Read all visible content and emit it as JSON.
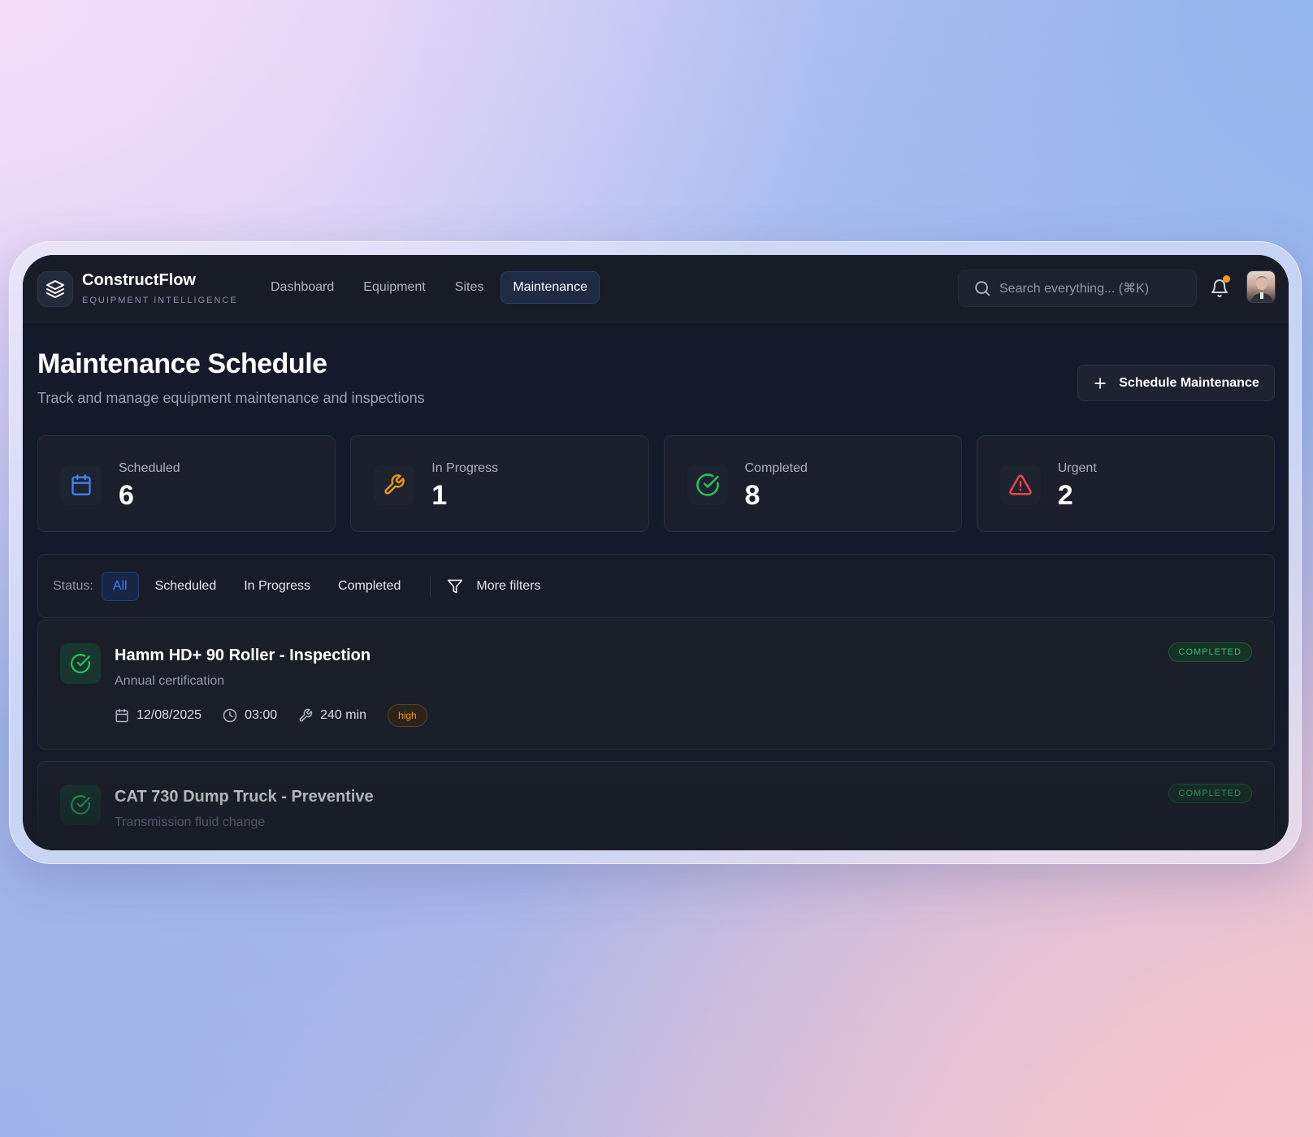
{
  "app": {
    "name": "ConstructFlow",
    "tagline": "EQUIPMENT INTELLIGENCE"
  },
  "nav": {
    "items": [
      {
        "label": "Dashboard",
        "active": false
      },
      {
        "label": "Equipment",
        "active": false
      },
      {
        "label": "Sites",
        "active": false
      },
      {
        "label": "Maintenance",
        "active": true
      }
    ]
  },
  "search": {
    "placeholder": "Search everything... (⌘K)"
  },
  "notifications": {
    "has_unread": true
  },
  "header": {
    "title": "Maintenance Schedule",
    "subtitle": "Track and manage equipment maintenance and inspections",
    "primary_action": "Schedule Maintenance"
  },
  "stats": [
    {
      "label": "Scheduled",
      "value": "6",
      "icon": "calendar-icon",
      "color": "#3b82f6"
    },
    {
      "label": "In Progress",
      "value": "1",
      "icon": "wrench-icon",
      "color": "#f59e0b"
    },
    {
      "label": "Completed",
      "value": "8",
      "icon": "check-circle-icon",
      "color": "#22c55e"
    },
    {
      "label": "Urgent",
      "value": "2",
      "icon": "alert-triangle-icon",
      "color": "#ef4444"
    }
  ],
  "filters": {
    "status_label": "Status:",
    "options": [
      {
        "label": "All",
        "active": true
      },
      {
        "label": "Scheduled",
        "active": false
      },
      {
        "label": "In Progress",
        "active": false
      },
      {
        "label": "Completed",
        "active": false
      }
    ],
    "more_label": "More filters"
  },
  "maintenance_items": [
    {
      "title": "Hamm HD+ 90 Roller - Inspection",
      "description": "Annual certification",
      "date": "12/08/2025",
      "time": "03:00",
      "duration": "240 min",
      "priority": "high",
      "status": "COMPLETED"
    },
    {
      "title": "CAT 730 Dump Truck - Preventive",
      "description": "Transmission fluid change",
      "status": "COMPLETED"
    }
  ],
  "colors": {
    "accent": "#3b82f6",
    "success": "#22c55e",
    "warning": "#f59e0b",
    "danger": "#ef4444"
  }
}
